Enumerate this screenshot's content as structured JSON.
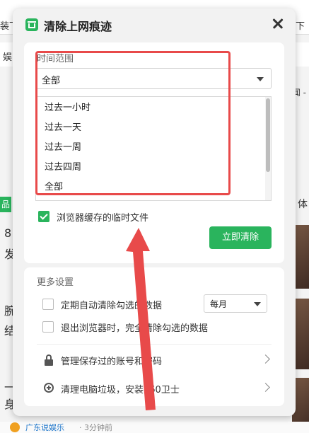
{
  "background": {
    "top_left_text": "装下",
    "top_right_text": "下",
    "nav_left_text": "娱",
    "right_top_text": "闻 -",
    "green_chip": "品",
    "right_label": "体",
    "left_texts": [
      "8",
      "发",
      "腕",
      "结",
      "一",
      "身"
    ],
    "feed_source": "广东说娱乐",
    "feed_time": "· 3分钟前"
  },
  "dialog": {
    "title": "清除上网痕迹",
    "time_range_label": "时间范围",
    "selected_range": "全部",
    "range_options": [
      "过去一小时",
      "过去一天",
      "过去一周",
      "过去四周",
      "全部"
    ],
    "cache_checkbox_label": "浏览器缓存的临时文件",
    "clear_button": "立即清除",
    "more_settings_title": "更多设置",
    "auto_clear_label": "定期自动清除勾选的数据",
    "frequency_value": "每月",
    "exit_clear_label": "退出浏览器时，完全清除勾选的数据",
    "manage_passwords_label": "管理保存过的账号和密码",
    "clean_pc_label": "清理电脑垃圾，安装360卫士"
  },
  "colors": {
    "accent_green": "#2ab45d",
    "annotation_red": "#e84a4a"
  }
}
